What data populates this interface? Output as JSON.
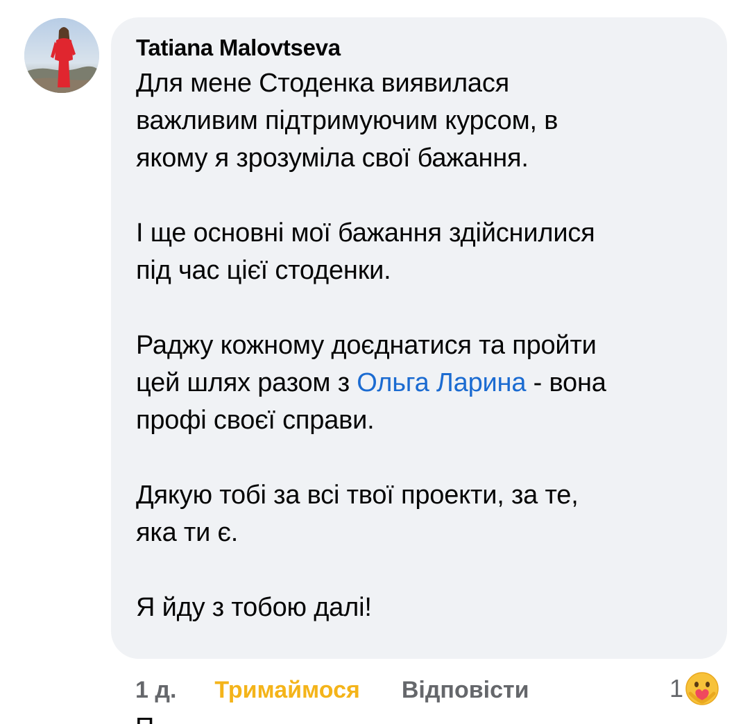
{
  "comment": {
    "author": "Tatiana Malovtseva",
    "paragraphs": [
      "Для мене Стоденка виявилася\nважливим підтримуючим курсом, в\nякому я зрозуміла свої бажання.",
      "І ще основні мої бажання здійснилися\nпід час цієї стоденки."
    ],
    "mention_paragraph": {
      "before": "Раджу кожному доєднатися та пройти\nцей шлях разом з ",
      "mention": "Ольга Ларина",
      "after": " - вона\nпрофі своєї справи."
    },
    "paragraphs_after": [
      "Дякую тобі за всі твої проекти, за те,\nяка ти є.",
      "Я йду з тобою далі!"
    ]
  },
  "actions": {
    "time": "1 д.",
    "react_label": "Тримаймося",
    "reply_label": "Відповісти",
    "reaction_count": "1",
    "reaction_icon": "care-emoji-icon"
  },
  "next_line_partial": "П",
  "colors": {
    "bubble_bg": "#f0f2f5",
    "mention": "#1b6bd1",
    "react_active": "#f4b41a",
    "muted": "#65676b"
  }
}
